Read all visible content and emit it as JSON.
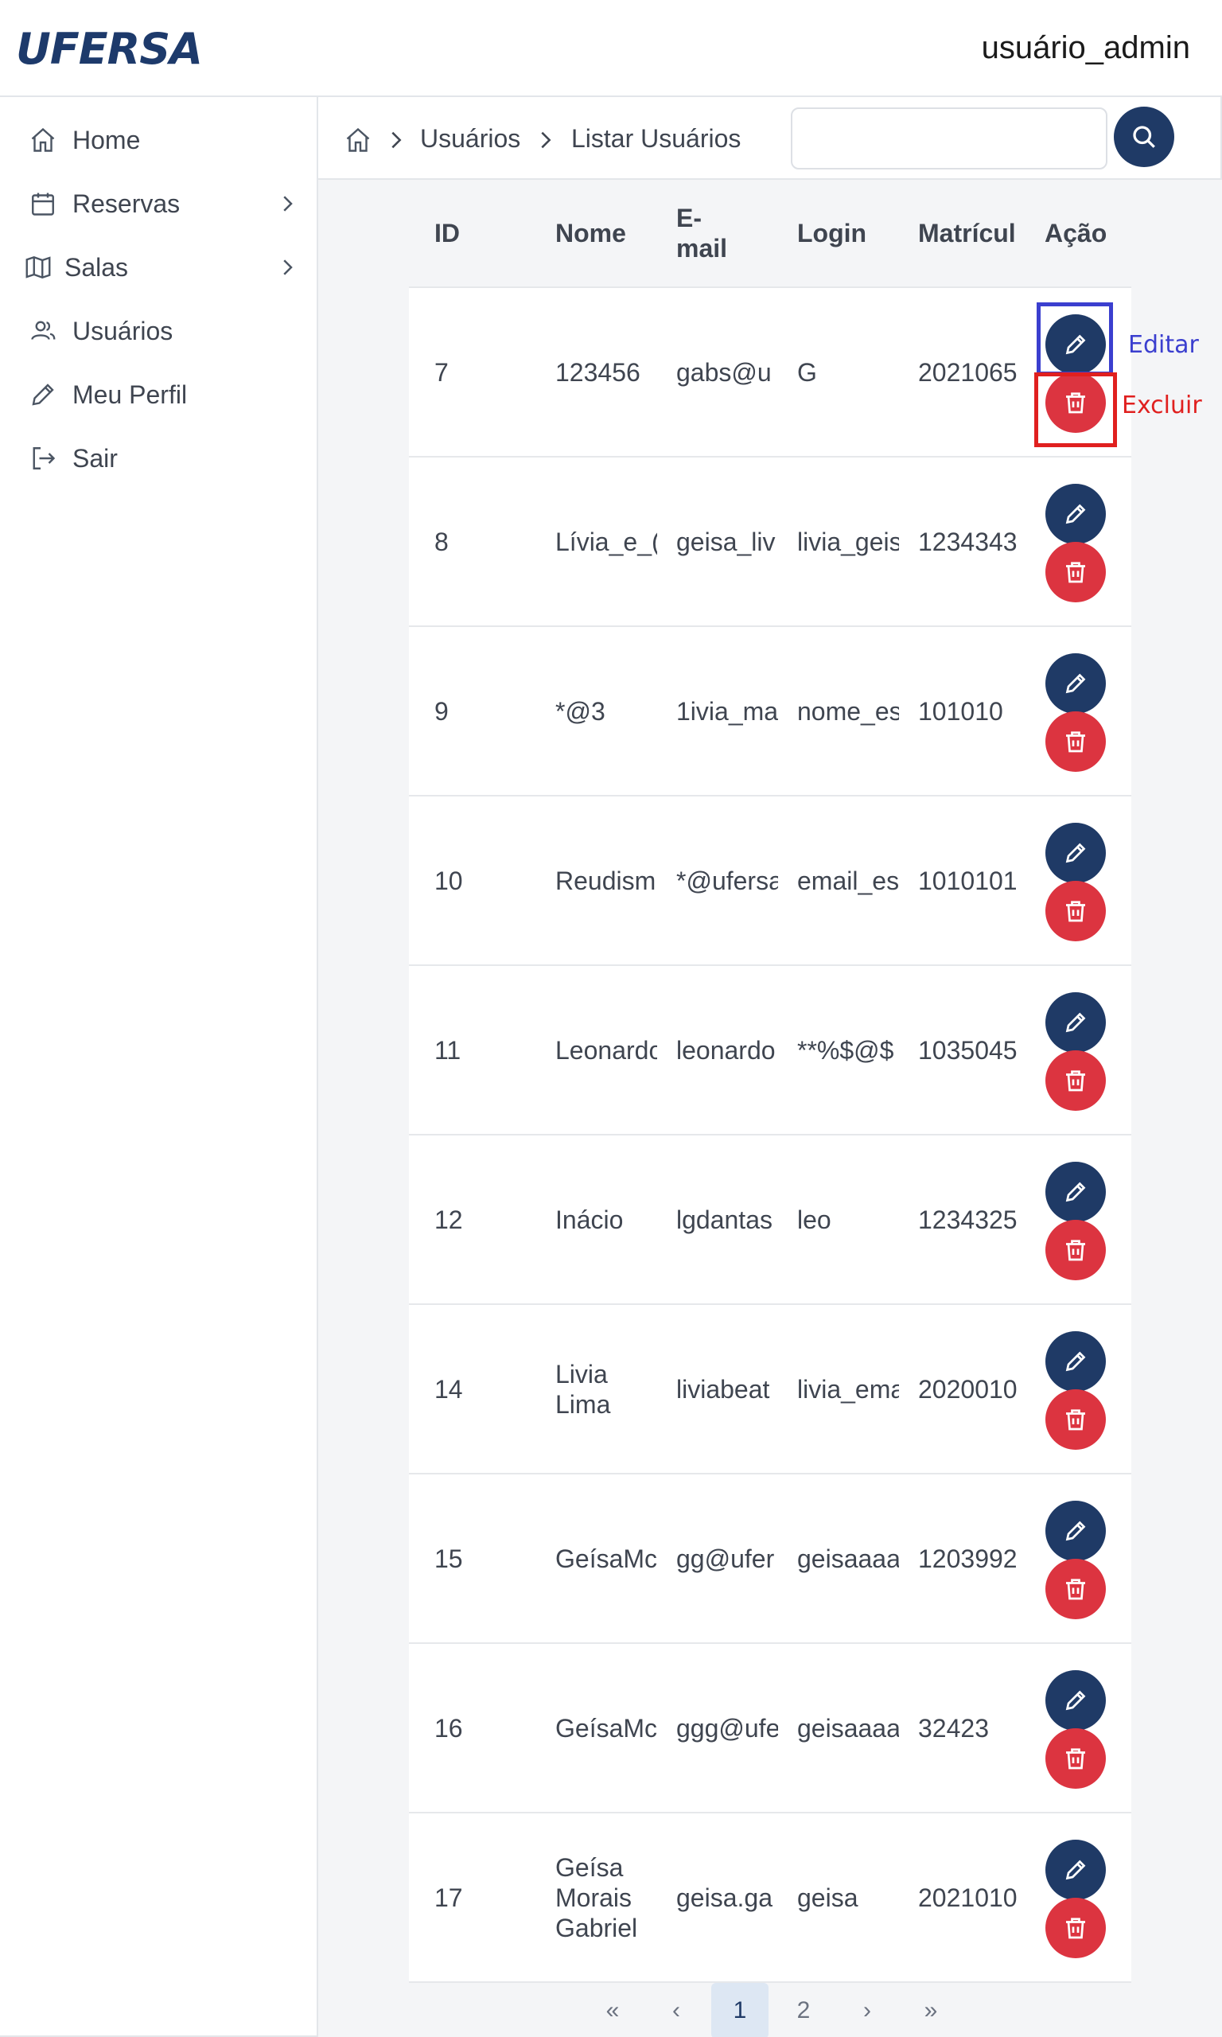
{
  "header": {
    "logo": "UFERSA",
    "user": "usuário_admin"
  },
  "sidebar": {
    "items": [
      {
        "label": "Home",
        "icon": "home-icon",
        "has_submenu": false
      },
      {
        "label": "Reservas",
        "icon": "calendar-icon",
        "has_submenu": true
      },
      {
        "label": "Salas",
        "icon": "map-icon",
        "has_submenu": true
      },
      {
        "label": "Usuários",
        "icon": "users-icon",
        "has_submenu": false
      },
      {
        "label": "Meu Perfil",
        "icon": "pencil-icon",
        "has_submenu": false
      },
      {
        "label": "Sair",
        "icon": "logout-icon",
        "has_submenu": false
      }
    ]
  },
  "breadcrumb": {
    "items": [
      "Usuários",
      "Listar Usuários"
    ]
  },
  "search": {
    "value": "",
    "placeholder": ""
  },
  "table": {
    "columns": [
      "ID",
      "Nome",
      "E-mail",
      "Login",
      "Matrícul",
      "Ação"
    ],
    "rows": [
      {
        "id": "7",
        "nome": "123456",
        "email": "gabs@u",
        "login": "G",
        "matricula": "2021065"
      },
      {
        "id": "8",
        "nome": "Lívia_e_(",
        "email": "geisa_liv",
        "login": "livia_geis",
        "matricula": "1234343"
      },
      {
        "id": "9",
        "nome": "*@3",
        "email": "1ivia_ma",
        "login": "nome_es",
        "matricula": "101010"
      },
      {
        "id": "10",
        "nome": "Reudism",
        "email": "*@ufersa",
        "login": "email_es",
        "matricula": "1010101"
      },
      {
        "id": "11",
        "nome": "Leonardo",
        "email": "leonardo",
        "login": "**%$@$",
        "matricula": "1035045"
      },
      {
        "id": "12",
        "nome": "Inácio",
        "email": "lgdantas",
        "login": "leo",
        "matricula": "1234325"
      },
      {
        "id": "14",
        "nome": "Livia Lima",
        "email": "liviabeat",
        "login": "livia_ema",
        "matricula": "2020010"
      },
      {
        "id": "15",
        "nome": "GeísaMc",
        "email": "gg@ufer",
        "login": "geisaaaa",
        "matricula": "1203992"
      },
      {
        "id": "16",
        "nome": "GeísaMc",
        "email": "ggg@ufe",
        "login": "geisaaaa",
        "matricula": "32423"
      },
      {
        "id": "17",
        "nome": "Geísa Morais Gabriel",
        "email": "geisa.ga",
        "login": "geisa",
        "matricula": "2021010"
      }
    ]
  },
  "annotations": {
    "edit_label": "Editar",
    "delete_label": "Excluir"
  },
  "pagination": {
    "pages": [
      "1",
      "2"
    ],
    "current": "1"
  },
  "colors": {
    "primary": "#1f3a66",
    "danger": "#dc3440",
    "annotation_blue": "#3b3fcf",
    "annotation_red": "#e0201f"
  }
}
